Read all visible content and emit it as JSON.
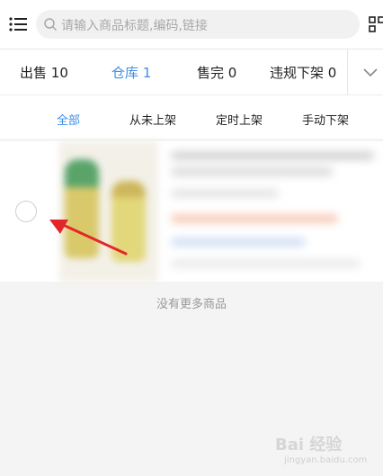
{
  "search": {
    "placeholder": "请输入商品标题,编码,链接"
  },
  "status_tabs": [
    {
      "label": "出售",
      "count": "10"
    },
    {
      "label": "仓库",
      "count": "1"
    },
    {
      "label": "售完",
      "count": "0"
    },
    {
      "label": "违规下架",
      "count": "0"
    }
  ],
  "filter_tabs": [
    "全部",
    "从未上架",
    "定时上架",
    "手动下架"
  ],
  "footer": {
    "no_more": "没有更多商品"
  },
  "watermark": {
    "brand": "Bai 经验",
    "url": "jingyan.baidu.com"
  },
  "colors": {
    "accent": "#3d8ee6",
    "annotation_arrow": "#e4262a"
  },
  "icons": [
    "menu-icon",
    "search-icon",
    "scan-icon",
    "chevron-down-icon"
  ]
}
